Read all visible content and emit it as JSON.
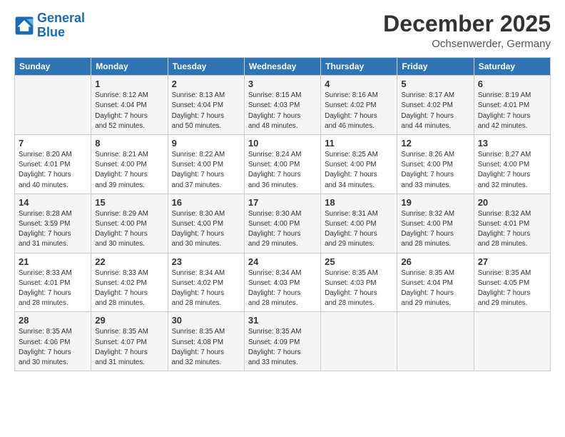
{
  "header": {
    "logo_line1": "General",
    "logo_line2": "Blue",
    "month": "December 2025",
    "location": "Ochsenwerder, Germany"
  },
  "days_of_week": [
    "Sunday",
    "Monday",
    "Tuesday",
    "Wednesday",
    "Thursday",
    "Friday",
    "Saturday"
  ],
  "weeks": [
    [
      {
        "day": "",
        "info": ""
      },
      {
        "day": "1",
        "info": "Sunrise: 8:12 AM\nSunset: 4:04 PM\nDaylight: 7 hours\nand 52 minutes."
      },
      {
        "day": "2",
        "info": "Sunrise: 8:13 AM\nSunset: 4:04 PM\nDaylight: 7 hours\nand 50 minutes."
      },
      {
        "day": "3",
        "info": "Sunrise: 8:15 AM\nSunset: 4:03 PM\nDaylight: 7 hours\nand 48 minutes."
      },
      {
        "day": "4",
        "info": "Sunrise: 8:16 AM\nSunset: 4:02 PM\nDaylight: 7 hours\nand 46 minutes."
      },
      {
        "day": "5",
        "info": "Sunrise: 8:17 AM\nSunset: 4:02 PM\nDaylight: 7 hours\nand 44 minutes."
      },
      {
        "day": "6",
        "info": "Sunrise: 8:19 AM\nSunset: 4:01 PM\nDaylight: 7 hours\nand 42 minutes."
      }
    ],
    [
      {
        "day": "7",
        "info": "Sunrise: 8:20 AM\nSunset: 4:01 PM\nDaylight: 7 hours\nand 40 minutes."
      },
      {
        "day": "8",
        "info": "Sunrise: 8:21 AM\nSunset: 4:00 PM\nDaylight: 7 hours\nand 39 minutes."
      },
      {
        "day": "9",
        "info": "Sunrise: 8:22 AM\nSunset: 4:00 PM\nDaylight: 7 hours\nand 37 minutes."
      },
      {
        "day": "10",
        "info": "Sunrise: 8:24 AM\nSunset: 4:00 PM\nDaylight: 7 hours\nand 36 minutes."
      },
      {
        "day": "11",
        "info": "Sunrise: 8:25 AM\nSunset: 4:00 PM\nDaylight: 7 hours\nand 34 minutes."
      },
      {
        "day": "12",
        "info": "Sunrise: 8:26 AM\nSunset: 4:00 PM\nDaylight: 7 hours\nand 33 minutes."
      },
      {
        "day": "13",
        "info": "Sunrise: 8:27 AM\nSunset: 4:00 PM\nDaylight: 7 hours\nand 32 minutes."
      }
    ],
    [
      {
        "day": "14",
        "info": "Sunrise: 8:28 AM\nSunset: 3:59 PM\nDaylight: 7 hours\nand 31 minutes."
      },
      {
        "day": "15",
        "info": "Sunrise: 8:29 AM\nSunset: 4:00 PM\nDaylight: 7 hours\nand 30 minutes."
      },
      {
        "day": "16",
        "info": "Sunrise: 8:30 AM\nSunset: 4:00 PM\nDaylight: 7 hours\nand 30 minutes."
      },
      {
        "day": "17",
        "info": "Sunrise: 8:30 AM\nSunset: 4:00 PM\nDaylight: 7 hours\nand 29 minutes."
      },
      {
        "day": "18",
        "info": "Sunrise: 8:31 AM\nSunset: 4:00 PM\nDaylight: 7 hours\nand 29 minutes."
      },
      {
        "day": "19",
        "info": "Sunrise: 8:32 AM\nSunset: 4:00 PM\nDaylight: 7 hours\nand 28 minutes."
      },
      {
        "day": "20",
        "info": "Sunrise: 8:32 AM\nSunset: 4:01 PM\nDaylight: 7 hours\nand 28 minutes."
      }
    ],
    [
      {
        "day": "21",
        "info": "Sunrise: 8:33 AM\nSunset: 4:01 PM\nDaylight: 7 hours\nand 28 minutes."
      },
      {
        "day": "22",
        "info": "Sunrise: 8:33 AM\nSunset: 4:02 PM\nDaylight: 7 hours\nand 28 minutes."
      },
      {
        "day": "23",
        "info": "Sunrise: 8:34 AM\nSunset: 4:02 PM\nDaylight: 7 hours\nand 28 minutes."
      },
      {
        "day": "24",
        "info": "Sunrise: 8:34 AM\nSunset: 4:03 PM\nDaylight: 7 hours\nand 28 minutes."
      },
      {
        "day": "25",
        "info": "Sunrise: 8:35 AM\nSunset: 4:03 PM\nDaylight: 7 hours\nand 28 minutes."
      },
      {
        "day": "26",
        "info": "Sunrise: 8:35 AM\nSunset: 4:04 PM\nDaylight: 7 hours\nand 29 minutes."
      },
      {
        "day": "27",
        "info": "Sunrise: 8:35 AM\nSunset: 4:05 PM\nDaylight: 7 hours\nand 29 minutes."
      }
    ],
    [
      {
        "day": "28",
        "info": "Sunrise: 8:35 AM\nSunset: 4:06 PM\nDaylight: 7 hours\nand 30 minutes."
      },
      {
        "day": "29",
        "info": "Sunrise: 8:35 AM\nSunset: 4:07 PM\nDaylight: 7 hours\nand 31 minutes."
      },
      {
        "day": "30",
        "info": "Sunrise: 8:35 AM\nSunset: 4:08 PM\nDaylight: 7 hours\nand 32 minutes."
      },
      {
        "day": "31",
        "info": "Sunrise: 8:35 AM\nSunset: 4:09 PM\nDaylight: 7 hours\nand 33 minutes."
      },
      {
        "day": "",
        "info": ""
      },
      {
        "day": "",
        "info": ""
      },
      {
        "day": "",
        "info": ""
      }
    ]
  ]
}
